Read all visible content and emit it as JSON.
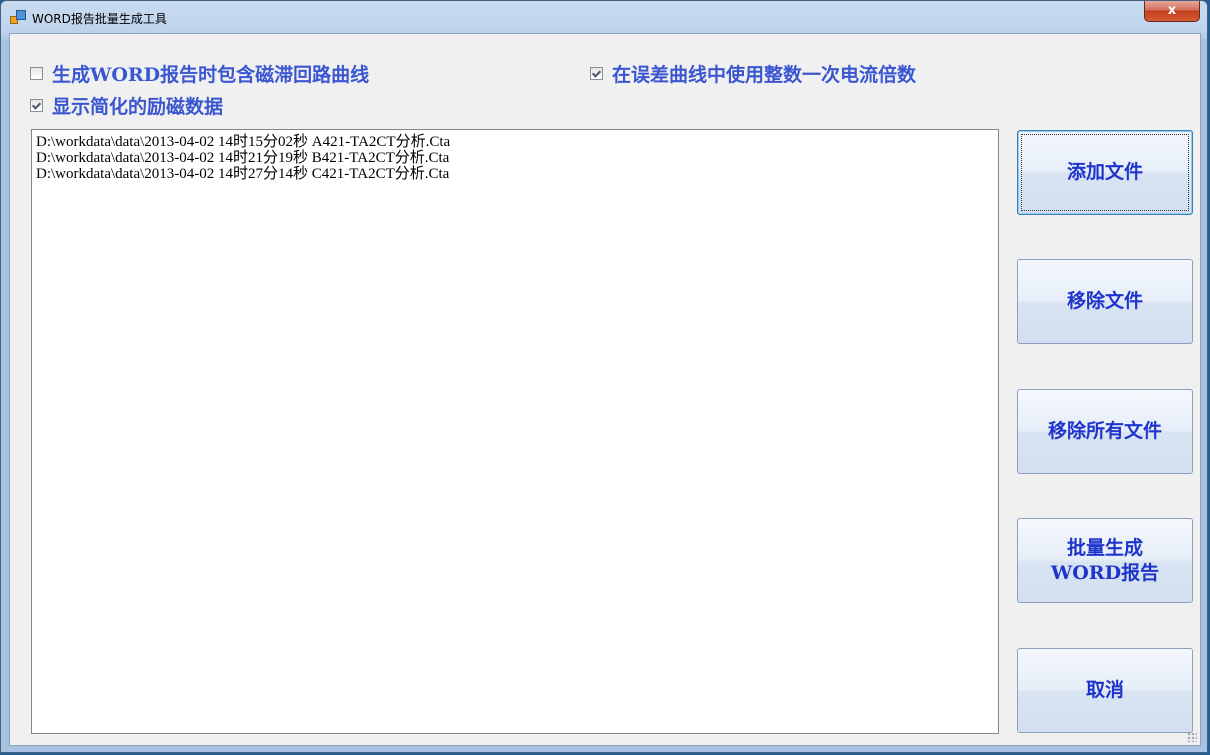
{
  "window": {
    "title": "WORD报告批量生成工具",
    "close_label": "x"
  },
  "options": [
    {
      "label": "生成WORD报告时包含磁滞回路曲线",
      "checked": false
    },
    {
      "label": "显示简化的励磁数据",
      "checked": true
    },
    {
      "label": "在误差曲线中使用整数一次电流倍数",
      "checked": true
    }
  ],
  "files": [
    "D:\\workdata\\data\\2013-04-02 14时15分02秒 A421-TA2CT分析.Cta",
    "D:\\workdata\\data\\2013-04-02 14时21分19秒 B421-TA2CT分析.Cta",
    "D:\\workdata\\data\\2013-04-02 14时27分14秒 C421-TA2CT分析.Cta"
  ],
  "buttons": {
    "add": "添加文件",
    "remove": "移除文件",
    "remove_all": "移除所有文件",
    "generate_line1": "批量生成",
    "generate_line2": "WORD报告",
    "cancel": "取消"
  },
  "colors": {
    "label_blue": "#3a56d0",
    "button_text": "#1f34cc",
    "close_red": "#c3401e"
  }
}
